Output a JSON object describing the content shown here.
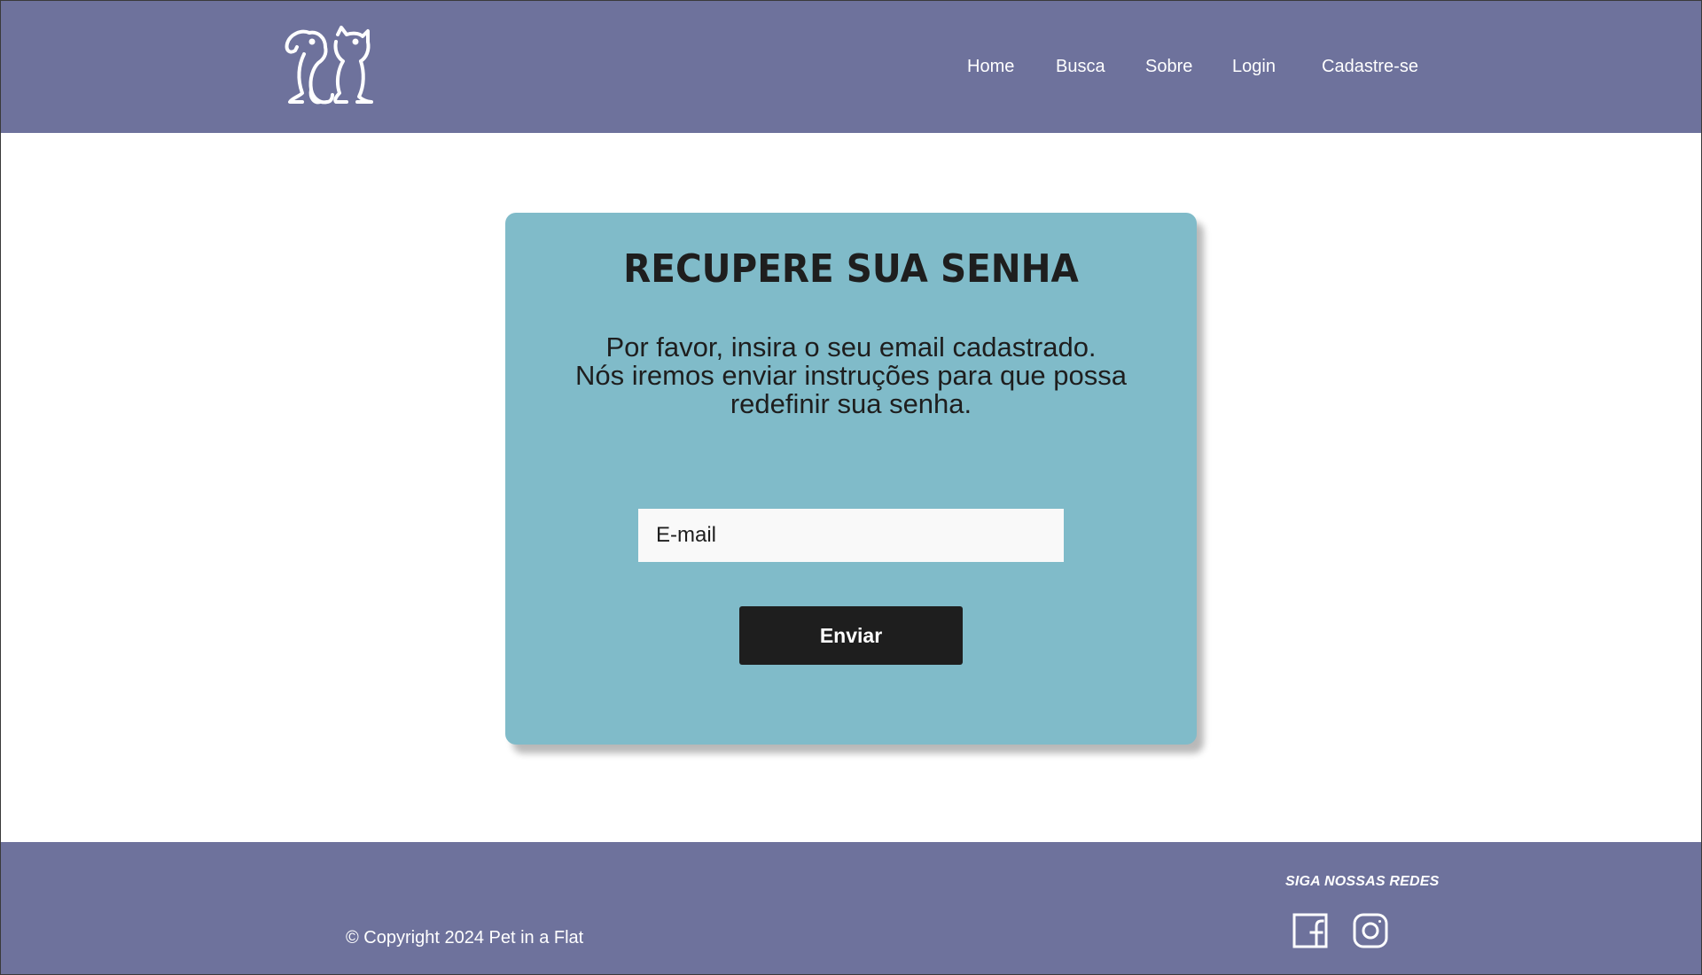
{
  "header": {
    "logo_icon": "dog-and-cat-logo-icon",
    "nav": {
      "home": "Home",
      "busca": "Busca",
      "sobre": "Sobre",
      "login": "Login",
      "cadastre": "Cadastre-se"
    }
  },
  "recover": {
    "title": "RECUPERE SUA SENHA",
    "description_lines": [
      "Por favor, insira o seu email cadastrado.",
      "Nós iremos enviar instruções para que possa",
      "redefinir sua senha."
    ],
    "email_placeholder": "E-mail",
    "email_value": "",
    "submit_label": "Enviar"
  },
  "footer": {
    "copyright": "© Copyright 2024 Pet in a Flat",
    "social_title": "SIGA NOSSAS REDES",
    "social_icons": [
      "facebook-icon",
      "instagram-icon"
    ]
  },
  "colors": {
    "header_footer_bg": "#6e729c",
    "card_bg": "#80bbc9",
    "button_bg": "#1e1e1e",
    "input_bg": "#f9f9f9",
    "text_dark": "#1e1e1e",
    "text_light": "#ffffff"
  }
}
